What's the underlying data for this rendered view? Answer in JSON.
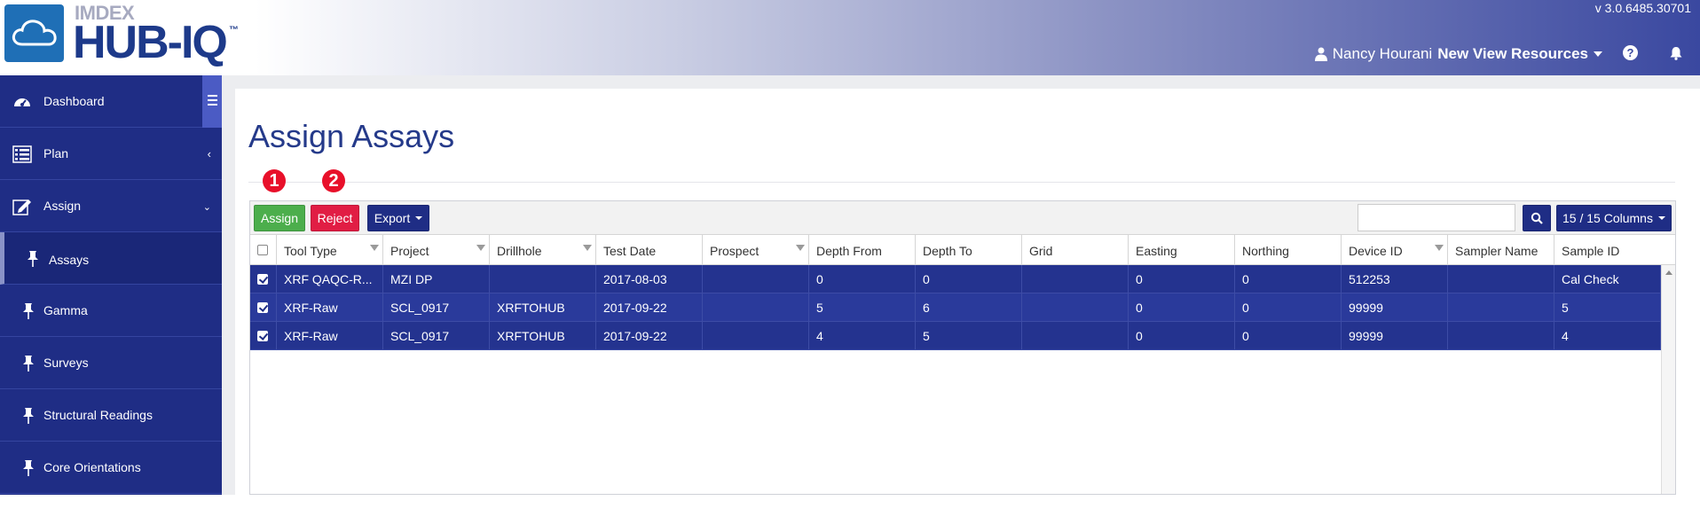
{
  "header": {
    "brand_small": "IMDEX",
    "brand_main": "HUB-IQ",
    "brand_tm": "™",
    "version": "v 3.0.6485.30701",
    "user_name": "Nancy Hourani",
    "org_name": "New View Resources"
  },
  "sidebar": {
    "items": [
      {
        "label": "Dashboard",
        "icon": "dashboard-icon"
      },
      {
        "label": "Plan",
        "icon": "list-icon"
      },
      {
        "label": "Assign",
        "icon": "edit-icon"
      },
      {
        "label": "Assays",
        "icon": "pin-icon"
      },
      {
        "label": "Gamma",
        "icon": "pin-icon"
      },
      {
        "label": "Surveys",
        "icon": "pin-icon"
      },
      {
        "label": "Structural Readings",
        "icon": "pin-icon"
      },
      {
        "label": "Core Orientations",
        "icon": "pin-icon"
      }
    ]
  },
  "page": {
    "title": "Assign Assays",
    "badges": [
      "1",
      "2"
    ]
  },
  "toolbar": {
    "assign_label": "Assign",
    "reject_label": "Reject",
    "export_label": "Export",
    "search_value": "",
    "columns_label": "15 / 15 Columns"
  },
  "table": {
    "columns": [
      "Tool Type",
      "Project",
      "Drillhole",
      "Test Date",
      "Prospect",
      "Depth From",
      "Depth To",
      "Grid",
      "Easting",
      "Northing",
      "Device ID",
      "Sampler Name",
      "Sample ID"
    ],
    "rows": [
      {
        "checked": true,
        "cells": [
          "XRF QAQC-R...",
          "MZI DP",
          "",
          "2017-08-03",
          "",
          "0",
          "0",
          "",
          "0",
          "0",
          "512253",
          "",
          "Cal Check"
        ]
      },
      {
        "checked": true,
        "cells": [
          "XRF-Raw",
          "SCL_0917",
          "XRFTOHUB",
          "2017-09-22",
          "",
          "5",
          "6",
          "",
          "0",
          "0",
          "99999",
          "",
          "5"
        ]
      },
      {
        "checked": true,
        "cells": [
          "XRF-Raw",
          "SCL_0917",
          "XRFTOHUB",
          "2017-09-22",
          "",
          "4",
          "5",
          "",
          "0",
          "0",
          "99999",
          "",
          "4"
        ]
      }
    ]
  },
  "colors": {
    "sidebar": "#1f2d85",
    "accent": "#253a8a",
    "assign": "#4cae4c",
    "reject": "#e11d44",
    "badge": "#e8102a"
  }
}
